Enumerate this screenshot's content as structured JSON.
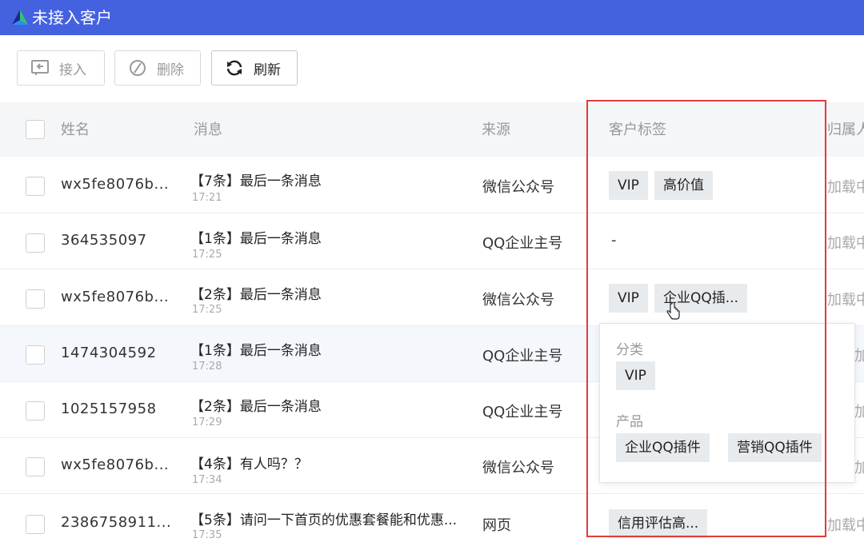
{
  "window": {
    "title": "未接入客户"
  },
  "toolbar": {
    "accept_label": "接入",
    "delete_label": "删除",
    "refresh_label": "刷新"
  },
  "table": {
    "headers": {
      "name": "姓名",
      "message": "消息",
      "source": "来源",
      "tags": "客户标签",
      "belong": "归属人"
    },
    "rows": [
      {
        "name": "wx5fe8076b...",
        "message": "【7条】最后一条消息",
        "time": "17:21",
        "source": "微信公众号",
        "tags": [
          "VIP",
          "高价值"
        ],
        "belong": "加载中"
      },
      {
        "name": "364535097",
        "message": "【1条】最后一条消息",
        "time": "17:25",
        "source": "QQ企业主号",
        "tags_empty": "-",
        "belong": "加载中"
      },
      {
        "name": "wx5fe8076b...",
        "message": "【2条】最后一条消息",
        "time": "17:25",
        "source": "微信公众号",
        "tags": [
          "VIP",
          "企业QQ插..."
        ],
        "belong": "加载中"
      },
      {
        "name": "1474304592",
        "message": "【1条】最后一条消息",
        "time": "17:28",
        "source": "QQ企业主号",
        "belong": "加"
      },
      {
        "name": "1025157958",
        "message": "【2条】最后一条消息",
        "time": "17:29",
        "source": "QQ企业主号",
        "belong": "加"
      },
      {
        "name": "wx5fe8076b...",
        "message": "【4条】有人吗？？",
        "time": "17:34",
        "source": "微信公众号",
        "belong": "加"
      },
      {
        "name": "2386758911...",
        "message": "【5条】请问一下首页的优惠套餐能和优惠...",
        "time": "17:35",
        "source": "网页",
        "tags": [
          "信用评估高..."
        ],
        "belong": "加载中"
      }
    ]
  },
  "tag_popup": {
    "groups": [
      {
        "label": "分类",
        "tags": [
          "VIP"
        ]
      },
      {
        "label": "产品",
        "tags": [
          "企业QQ插件",
          "营销QQ插件"
        ]
      }
    ]
  },
  "colors": {
    "titlebar": "#4461e0",
    "highlight": "#e23b3b",
    "tag_bg": "#e8ebed"
  }
}
